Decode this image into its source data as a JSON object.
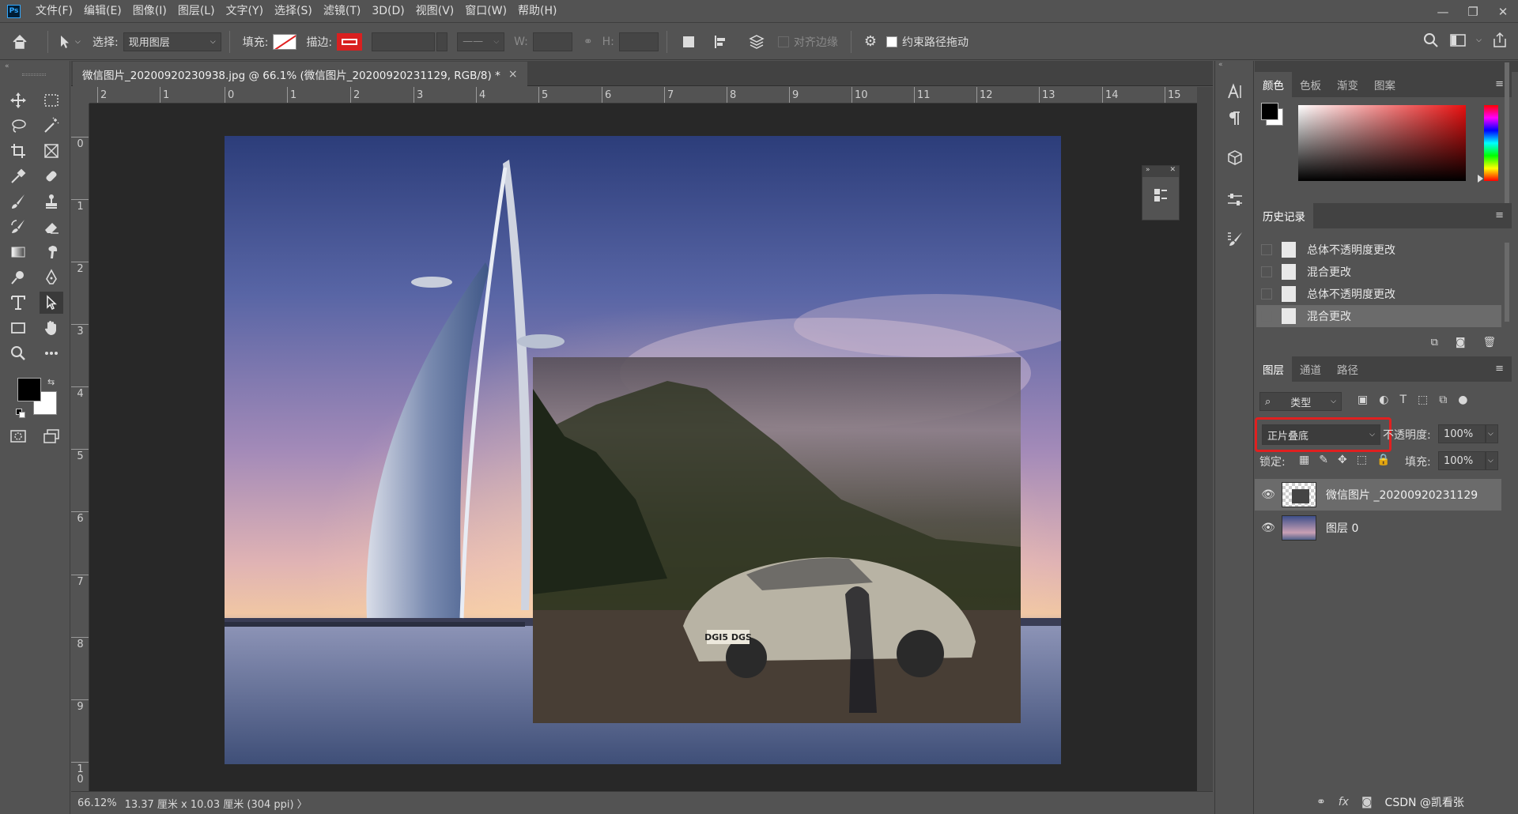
{
  "app": {
    "logo": "Ps"
  },
  "menu": [
    "文件(F)",
    "编辑(E)",
    "图像(I)",
    "图层(L)",
    "文字(Y)",
    "选择(S)",
    "滤镜(T)",
    "3D(D)",
    "视图(V)",
    "窗口(W)",
    "帮助(H)"
  ],
  "window_controls": {
    "minimize": "—",
    "restore": "❐",
    "close": "✕"
  },
  "options": {
    "select_label": "选择:",
    "select_value": "现用图层",
    "fill_label": "填充:",
    "stroke_label": "描边:",
    "w_label": "W:",
    "h_label": "H:",
    "align_edges": "对齐边缘",
    "constrain_path": "约束路径拖动"
  },
  "document": {
    "tab_title": "微信图片_20200920230938.jpg @ 66.1% (微信图片_20200920231129, RGB/8) *",
    "close": "×"
  },
  "ruler_h": [
    "2",
    "1",
    "0",
    "1",
    "2",
    "3",
    "4",
    "5",
    "6",
    "7",
    "8",
    "9",
    "10",
    "11",
    "12",
    "13",
    "14",
    "15"
  ],
  "ruler_v": [
    "0",
    "1",
    "2",
    "3",
    "4",
    "5",
    "6",
    "7",
    "8",
    "9",
    "1\n0"
  ],
  "status": {
    "zoom": "66.12%",
    "size": "13.37 厘米 x 10.03 厘米 (304 ppi)",
    "arrow": "〉"
  },
  "image": {
    "plate": "DGI5 DGS"
  },
  "color_panel": {
    "tabs": [
      "颜色",
      "色板",
      "渐变",
      "图案"
    ]
  },
  "history_panel": {
    "title": "历史记录",
    "items": [
      "总体不透明度更改",
      "混合更改",
      "总体不透明度更改",
      "混合更改"
    ]
  },
  "layers_panel": {
    "tabs": [
      "图层",
      "通道",
      "路径"
    ],
    "filter_label": "类型",
    "blend_mode": "正片叠底",
    "opacity_label": "不透明度:",
    "opacity_value": "100%",
    "lock_label": "锁定:",
    "fill_label": "填充:",
    "fill_value": "100%",
    "layers": [
      {
        "name": "微信图片 _20200920231129"
      },
      {
        "name": "图层 0"
      }
    ],
    "footer_watermark": "CSDN @凯看张"
  },
  "colors": {
    "highlight": "#e02020",
    "foreground": "#000000",
    "background": "#ffffff"
  }
}
